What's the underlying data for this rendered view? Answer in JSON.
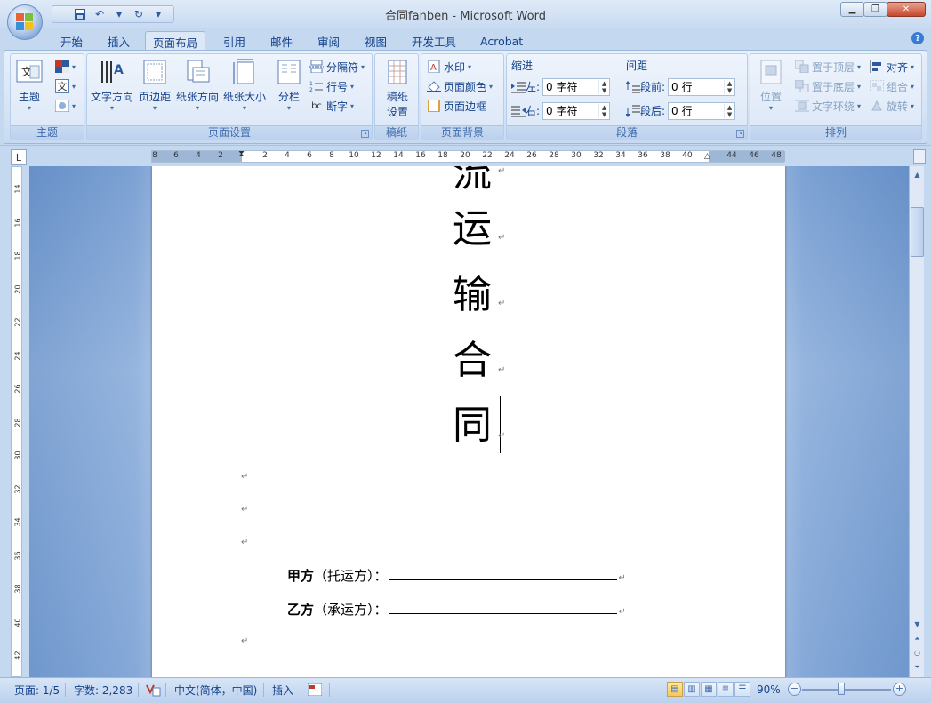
{
  "window": {
    "title": "合同fanben - Microsoft Word"
  },
  "qat": {
    "items": [
      "save-icon",
      "undo-icon",
      "redo-icon",
      "customize-icon"
    ]
  },
  "tabs": [
    "开始",
    "插入",
    "页面布局",
    "引用",
    "邮件",
    "审阅",
    "视图",
    "开发工具",
    "Acrobat"
  ],
  "active_tab": "页面布局",
  "ribbon": {
    "theme_group": {
      "label": "主题",
      "theme_button": "主题"
    },
    "page_setup": {
      "label": "页面设置",
      "text_direction": "文字方向",
      "margins": "页边距",
      "orientation": "纸张方向",
      "size": "纸张大小",
      "columns": "分栏",
      "breaks": "分隔符",
      "line_numbers": "行号",
      "hyphenation": "断字"
    },
    "manuscript": {
      "label": "稿纸",
      "button_line1": "稿纸",
      "button_line2": "设置"
    },
    "page_background": {
      "label": "页面背景",
      "watermark": "水印",
      "page_color": "页面颜色",
      "page_borders": "页面边框"
    },
    "paragraph": {
      "label": "段落",
      "indent_title": "缩进",
      "spacing_title": "间距",
      "left_label": "左:",
      "left_value": "0 字符",
      "right_label": "右:",
      "right_value": "0 字符",
      "before_label": "段前:",
      "before_value": "0 行",
      "after_label": "段后:",
      "after_value": "0 行"
    },
    "arrange": {
      "label": "排列",
      "position": "位置",
      "bring_front": "置于顶层",
      "send_back": "置于底层",
      "text_wrap": "文字环绕",
      "align": "对齐",
      "group": "组合",
      "rotate": "旋转"
    }
  },
  "ruler": {
    "numbers": [
      "8",
      "6",
      "4",
      "2",
      "2",
      "4",
      "6",
      "8",
      "10",
      "12",
      "14",
      "16",
      "18",
      "20",
      "22",
      "24",
      "26",
      "28",
      "30",
      "32",
      "34",
      "36",
      "38",
      "40",
      "44",
      "46",
      "48"
    ],
    "vnumbers": [
      "14",
      "16",
      "18",
      "20",
      "22",
      "24",
      "26",
      "28",
      "30",
      "32",
      "34",
      "36",
      "38",
      "40",
      "42"
    ]
  },
  "document": {
    "title_chars": [
      "流",
      "运",
      "输",
      "合",
      "同"
    ],
    "party_a_bold": "甲方",
    "party_a_rest": "（托运方）：",
    "party_b_bold": "乙方",
    "party_b_rest": "（承运方）："
  },
  "status": {
    "page": "页面: 1/5",
    "words": "字数: 2,283",
    "language": "中文(简体，中国)",
    "mode": "插入",
    "zoom": "90%"
  }
}
